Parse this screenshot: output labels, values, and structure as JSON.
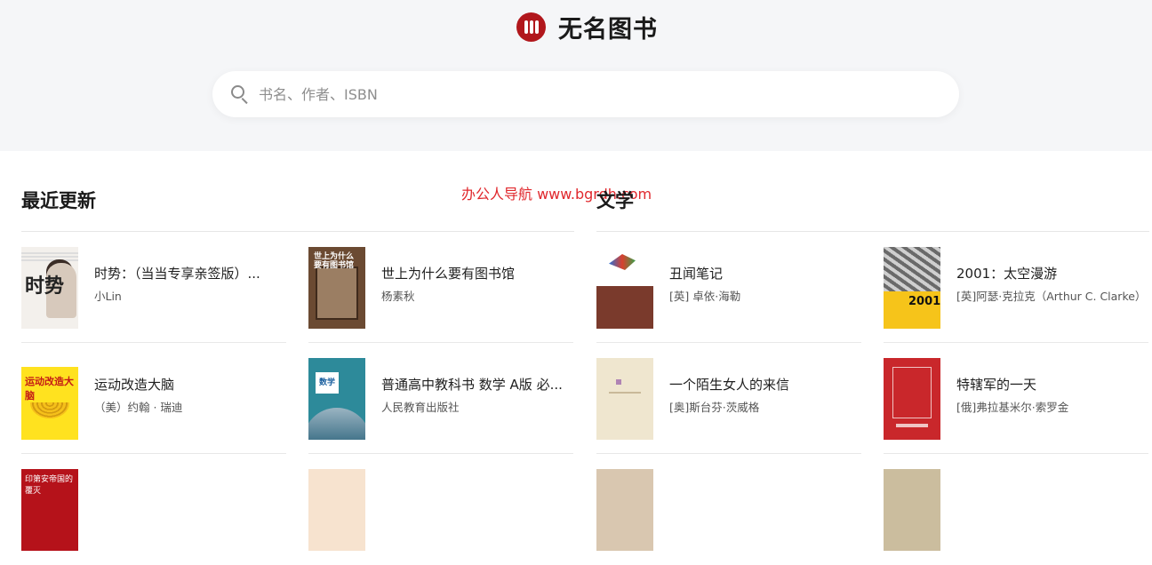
{
  "header": {
    "site_name": "无名图书",
    "search_placeholder": "书名、作者、ISBN",
    "search_value": ""
  },
  "watermark": "办公人导航 www.bgrdh.com",
  "sections": [
    {
      "title": "最近更新",
      "books": [
        {
          "title": "时势：（当当专享亲签版）...",
          "author": "小Lin",
          "cover_icon": "book-cover"
        },
        {
          "title": "世上为什么要有图书馆",
          "author": "杨素秋",
          "cover_icon": "book-cover"
        },
        {
          "title": "运动改造大脑",
          "author": "（美）约翰 · 瑞迪",
          "cover_icon": "book-cover"
        },
        {
          "title": "普通高中教科书 数学 A版 必...",
          "author": "人民教育出版社",
          "cover_icon": "book-cover"
        },
        {
          "title": "",
          "author": "",
          "cover_icon": "book-cover"
        },
        {
          "title": "",
          "author": "",
          "cover_icon": "book-cover"
        }
      ]
    },
    {
      "title": "文学",
      "books": [
        {
          "title": "丑闻笔记",
          "author": "[英] 卓依·海勒",
          "cover_icon": "book-cover"
        },
        {
          "title": "2001：太空漫游",
          "author": "[英]阿瑟·克拉克（Arthur C. Clarke）",
          "cover_icon": "book-cover"
        },
        {
          "title": "一个陌生女人的来信",
          "author": "[奥]斯台芬·茨威格",
          "cover_icon": "book-cover"
        },
        {
          "title": "特辖军的一天",
          "author": "[俄]弗拉基米尔·索罗金",
          "cover_icon": "book-cover"
        },
        {
          "title": "",
          "author": "",
          "cover_icon": "book-cover"
        },
        {
          "title": "",
          "author": "",
          "cover_icon": "book-cover"
        }
      ]
    }
  ],
  "cover_text": {
    "c1": "时势",
    "c2": "世上为什么要有图书馆",
    "c3": "运动改造大脑",
    "c4": "数学",
    "c6": "2001",
    "c9": "印第安帝国的覆灭"
  },
  "colors": {
    "brand_red": "#b1171c",
    "watermark_red": "#e0282d",
    "header_bg": "#f5f6f8"
  }
}
